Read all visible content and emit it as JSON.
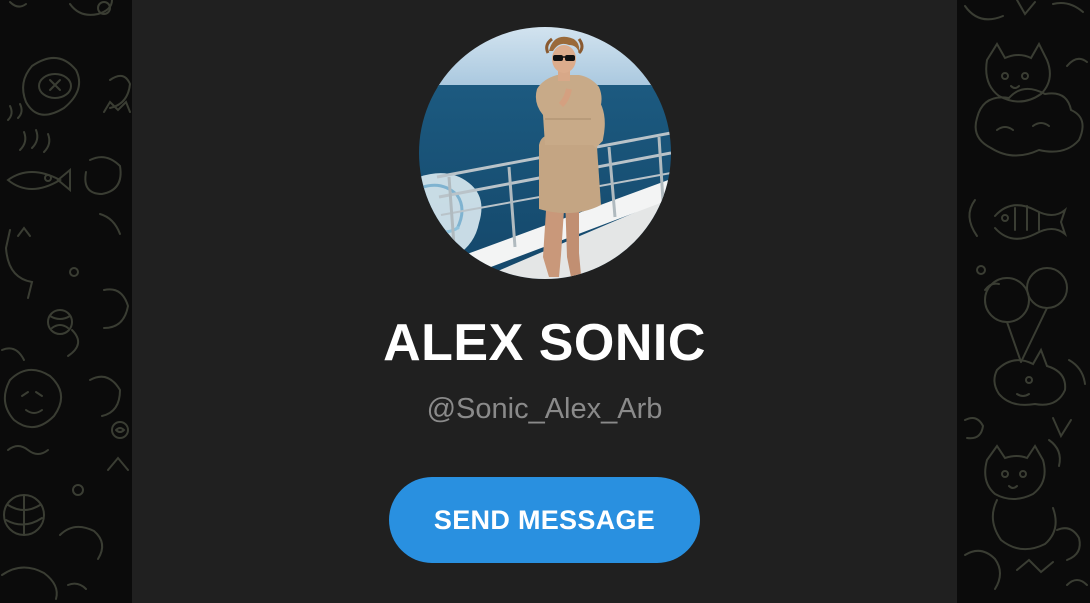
{
  "profile": {
    "name": "ALEX SONIC",
    "username": "@Sonic_Alex_Arb",
    "avatar_icon": "profile-photo"
  },
  "actions": {
    "send_message_label": "SEND MESSAGE"
  },
  "colors": {
    "page_background": "#0b0b0b",
    "card_background": "#202020",
    "name_text": "#ffffff",
    "username_text": "#8a8a8a",
    "button_background": "#2990e0",
    "button_text": "#ffffff",
    "doodle_stroke": "#3a3d33"
  }
}
